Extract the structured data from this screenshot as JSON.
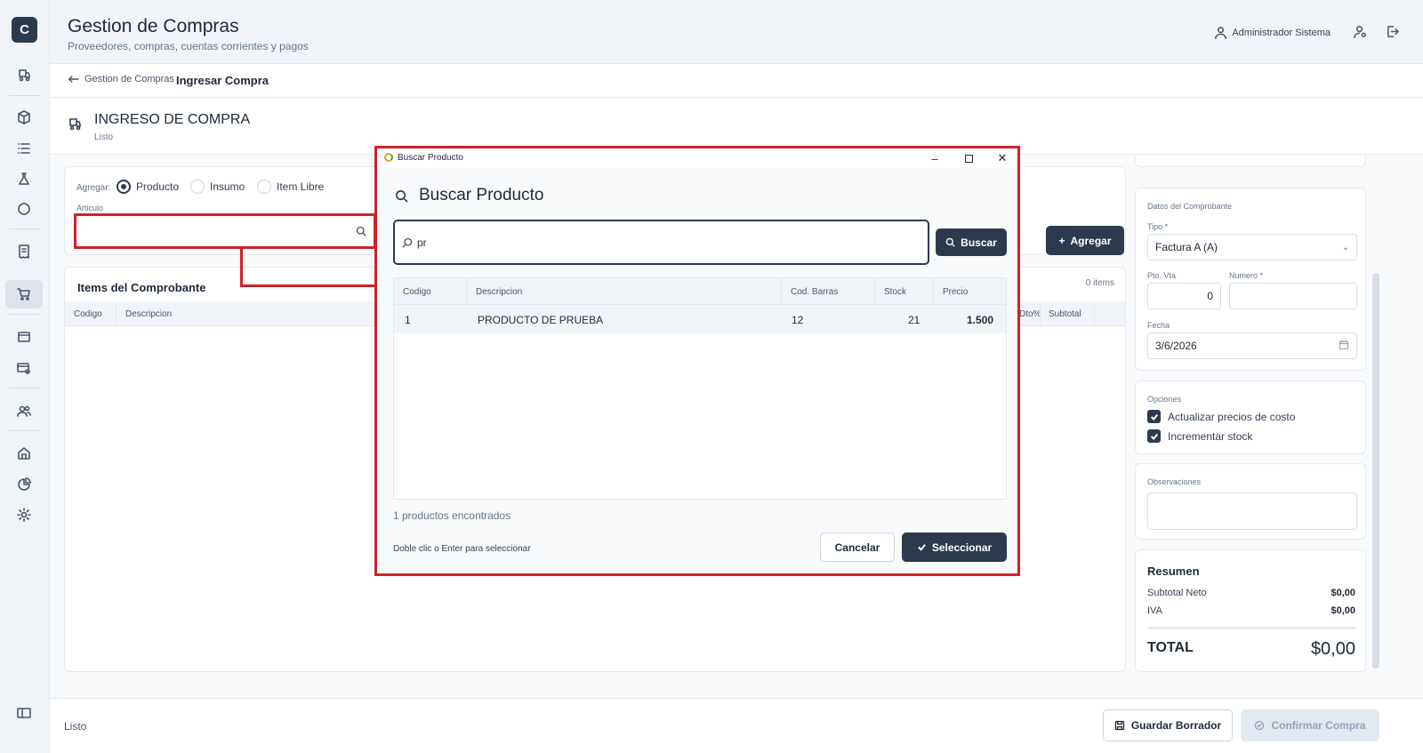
{
  "app": {
    "logo_letter": "C"
  },
  "header": {
    "title": "Gestion de Compras",
    "subtitle": "Proveedores, compras, cuentas corrientes y pagos",
    "user": "Administrador Sistema"
  },
  "breadcrumb": {
    "parent": "Gestion de Compras",
    "current": "Ingresar Compra"
  },
  "page": {
    "title": "INGRESO DE COMPRA",
    "status": "Listo"
  },
  "add_panel": {
    "agregar_label": "Agregar:",
    "options": [
      {
        "label": "Producto",
        "selected": true
      },
      {
        "label": "Insumo",
        "selected": false
      },
      {
        "label": "Item Libre",
        "selected": false
      }
    ],
    "articulo_label": "Articulo",
    "articulo_value": "",
    "add_button": "Agregar"
  },
  "items": {
    "title": "Items del Comprobante",
    "count": "0  items",
    "columns": {
      "codigo": "Codigo",
      "descripcion": "Descripcion",
      "dto": "Dto%",
      "subtotal": "Subtotal"
    }
  },
  "comprobante": {
    "section_title": "Datos del Comprobante",
    "tipo_label": "Tipo *",
    "tipo_value": "Factura A (A)",
    "pto_vta_label": "Pto. Vta",
    "pto_vta_value": "0",
    "numero_label": "Numero *",
    "numero_value": "",
    "fecha_label": "Fecha",
    "fecha_value": "3/6/2026"
  },
  "opciones": {
    "title": "Opciones",
    "items": [
      {
        "label": "Actualizar precios de costo",
        "checked": true
      },
      {
        "label": "Incrementar stock",
        "checked": true
      }
    ]
  },
  "observaciones": {
    "title": "Observaciones",
    "value": ""
  },
  "resumen": {
    "title": "Resumen",
    "subtotal_label": "Subtotal Neto",
    "subtotal_value": "$0,00",
    "iva_label": "IVA",
    "iva_value": "$0,00",
    "total_label": "TOTAL",
    "total_value": "$0,00"
  },
  "footer": {
    "status": "Listo",
    "draft_button": "Guardar Borrador",
    "confirm_button": "Confirmar Compra"
  },
  "modal": {
    "window_title": "Buscar Producto",
    "heading": "Buscar Producto",
    "search_value": "pr",
    "search_button": "Buscar",
    "columns": {
      "codigo": "Codigo",
      "descripcion": "Descripcion",
      "barras": "Cod. Barras",
      "stock": "Stock",
      "precio": "Precio"
    },
    "rows": [
      {
        "codigo": "1",
        "descripcion": "PRODUCTO DE PRUEBA",
        "barras": "12",
        "stock": "21",
        "precio": "1.500"
      }
    ],
    "found_text": "1  productos encontrados",
    "hint": "Doble clic o Enter para seleccionar",
    "cancel_button": "Cancelar",
    "select_button": "Seleccionar"
  },
  "colors": {
    "primary": "#2d3a4d",
    "highlight": "#d0212a",
    "sidebar_bg": "#f1f5f9"
  }
}
